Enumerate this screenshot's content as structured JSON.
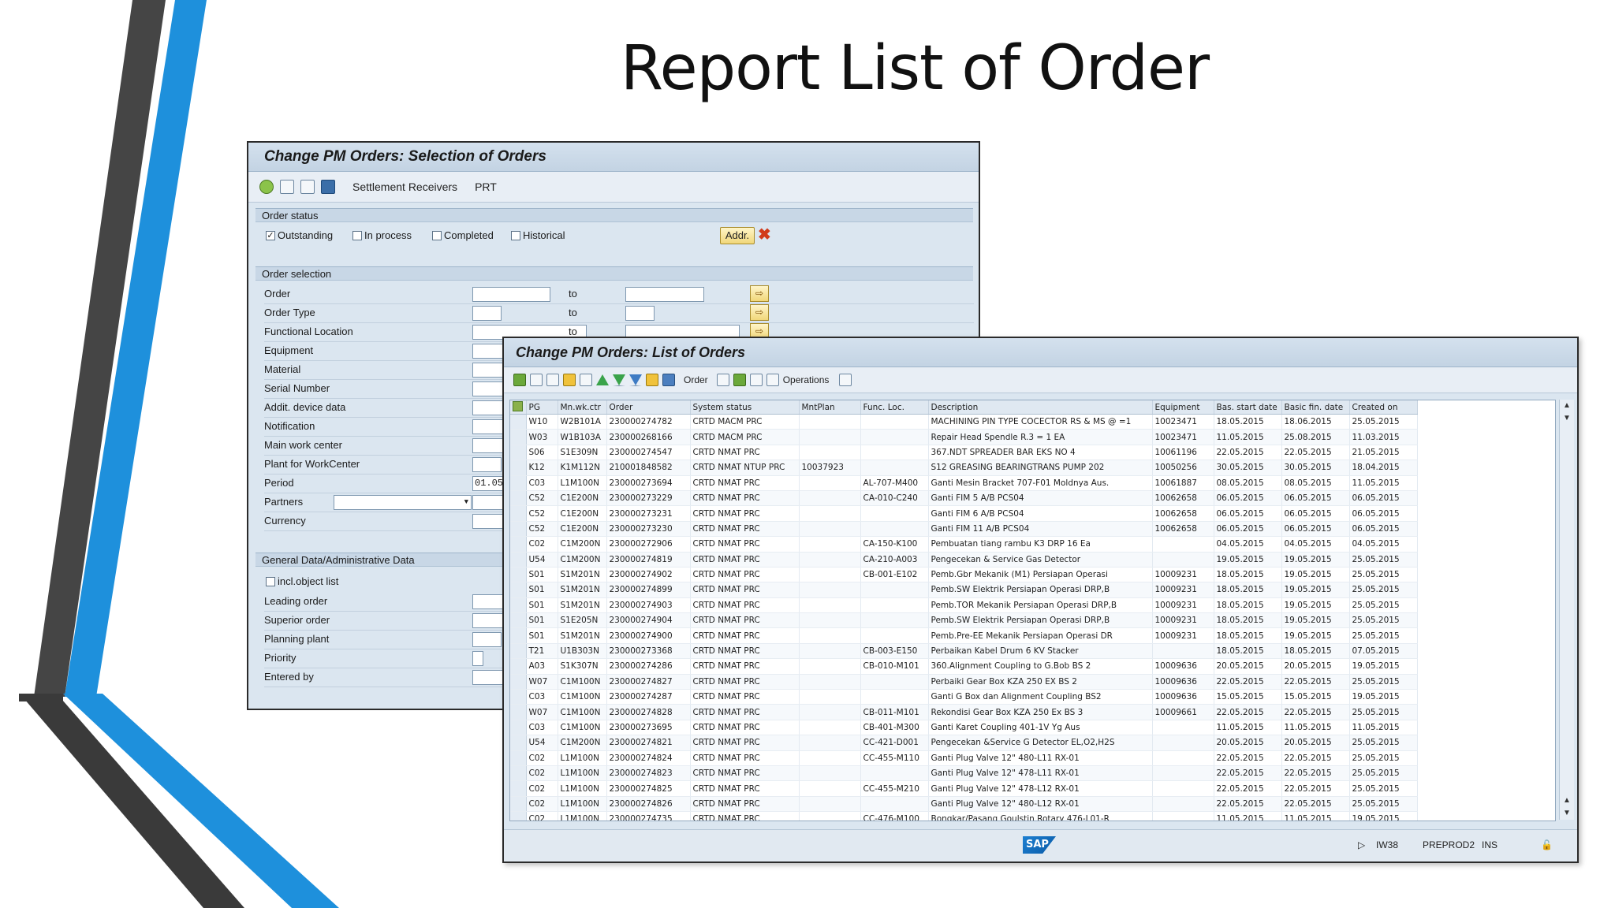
{
  "slide": {
    "title": "Report List of Order"
  },
  "colors": {
    "accent_blue": "#1e90dc",
    "accent_gray": "#4a4a4a",
    "sap_frame": "#dbe6f0"
  },
  "selection_window": {
    "title": "Change PM Orders: Selection of Orders",
    "toolbar": {
      "icons": [
        "execute-icon",
        "copy-icon",
        "get-variant-icon",
        "info-icon"
      ],
      "settlement_label": "Settlement Receivers",
      "prt_label": "PRT"
    },
    "order_status": {
      "header": "Order status",
      "outstanding": "Outstanding",
      "outstanding_checked": true,
      "in_process": "In process",
      "completed": "Completed",
      "historical": "Historical",
      "addr_button": "Addr."
    },
    "order_selection": {
      "header": "Order selection",
      "to_label": "to",
      "rows": {
        "order": "Order",
        "order_type": "Order Type",
        "functional_location": "Functional Location",
        "equipment": "Equipment",
        "material": "Material",
        "serial_number": "Serial Number",
        "addit_device_data": "Addit. device data",
        "notification": "Notification",
        "main_work_center": "Main work center",
        "plant_for_workcenter": "Plant for WorkCenter",
        "period": "Period",
        "period_value": "01.05.",
        "partners": "Partners",
        "currency": "Currency"
      }
    },
    "general_data": {
      "header": "General Data/Administrative Data",
      "incl_object_list": "incl.object list",
      "leading_order": "Leading order",
      "superior_order": "Superior order",
      "planning_plant": "Planning plant",
      "priority": "Priority",
      "entered_by": "Entered by"
    }
  },
  "list_window": {
    "title": "Change PM Orders: List of Orders",
    "toolbar": {
      "order_label": "Order",
      "operations_label": "Operations"
    },
    "columns": [
      "PG",
      "Mn.wk.ctr",
      "Order",
      "System status",
      "MntPlan",
      "Func. Loc.",
      "Description",
      "Equipment",
      "Bas. start date",
      "Basic fin. date",
      "Created on"
    ],
    "rows": [
      [
        "W10",
        "W2B101A",
        "230000274782",
        "CRTD MACM PRC",
        "",
        "",
        "MACHINING PIN TYPE COCECTOR RS & MS @ =1",
        "10023471",
        "18.05.2015",
        "18.06.2015",
        "25.05.2015"
      ],
      [
        "W03",
        "W1B103A",
        "230000268166",
        "CRTD MACM PRC",
        "",
        "",
        "Repair Head Spendle R.3 = 1 EA",
        "10023471",
        "11.05.2015",
        "25.08.2015",
        "11.03.2015"
      ],
      [
        "S06",
        "S1E309N",
        "230000274547",
        "CRTD NMAT PRC",
        "",
        "",
        "367.NDT SPREADER BAR EKS NO 4",
        "10061196",
        "22.05.2015",
        "22.05.2015",
        "21.05.2015"
      ],
      [
        "K12",
        "K1M112N",
        "210001848582",
        "CRTD NMAT NTUP PRC",
        "10037923",
        "",
        "S12 GREASING BEARINGTRANS PUMP 202",
        "10050256",
        "30.05.2015",
        "30.05.2015",
        "18.04.2015"
      ],
      [
        "C03",
        "L1M100N",
        "230000273694",
        "CRTD NMAT PRC",
        "",
        "AL-707-M400",
        "Ganti Mesin Bracket 707-F01 Moldnya Aus.",
        "10061887",
        "08.05.2015",
        "08.05.2015",
        "11.05.2015"
      ],
      [
        "C52",
        "C1E200N",
        "230000273229",
        "CRTD NMAT PRC",
        "",
        "CA-010-C240",
        "Ganti FIM 5 A/B PCS04",
        "10062658",
        "06.05.2015",
        "06.05.2015",
        "06.05.2015"
      ],
      [
        "C52",
        "C1E200N",
        "230000273231",
        "CRTD NMAT PRC",
        "",
        "",
        "Ganti FIM 6 A/B PCS04",
        "10062658",
        "06.05.2015",
        "06.05.2015",
        "06.05.2015"
      ],
      [
        "C52",
        "C1E200N",
        "230000273230",
        "CRTD NMAT PRC",
        "",
        "",
        "Ganti FIM 11 A/B PCS04",
        "10062658",
        "06.05.2015",
        "06.05.2015",
        "06.05.2015"
      ],
      [
        "C02",
        "C1M200N",
        "230000272906",
        "CRTD NMAT PRC",
        "",
        "CA-150-K100",
        "Pembuatan tiang rambu K3 DRP 16 Ea",
        "",
        "04.05.2015",
        "04.05.2015",
        "04.05.2015"
      ],
      [
        "U54",
        "C1M200N",
        "230000274819",
        "CRTD NMAT PRC",
        "",
        "CA-210-A003",
        "Pengecekan & Service Gas Detector",
        "",
        "19.05.2015",
        "19.05.2015",
        "25.05.2015"
      ],
      [
        "S01",
        "S1M201N",
        "230000274902",
        "CRTD NMAT PRC",
        "",
        "CB-001-E102",
        "Pemb.Gbr Mekanik (M1) Persiapan Operasi",
        "10009231",
        "18.05.2015",
        "19.05.2015",
        "25.05.2015"
      ],
      [
        "S01",
        "S1M201N",
        "230000274899",
        "CRTD NMAT PRC",
        "",
        "",
        "Pemb.SW Elektrik Persiapan Operasi DRP,B",
        "10009231",
        "18.05.2015",
        "19.05.2015",
        "25.05.2015"
      ],
      [
        "S01",
        "S1M201N",
        "230000274903",
        "CRTD NMAT PRC",
        "",
        "",
        "Pemb.TOR Mekanik Persiapan Operasi DRP,B",
        "10009231",
        "18.05.2015",
        "19.05.2015",
        "25.05.2015"
      ],
      [
        "S01",
        "S1E205N",
        "230000274904",
        "CRTD NMAT PRC",
        "",
        "",
        "Pemb.SW Elektrik Persiapan Operasi DRP,B",
        "10009231",
        "18.05.2015",
        "19.05.2015",
        "25.05.2015"
      ],
      [
        "S01",
        "S1M201N",
        "230000274900",
        "CRTD NMAT PRC",
        "",
        "",
        "Pemb.Pre-EE Mekanik Persiapan Operasi DR",
        "10009231",
        "18.05.2015",
        "19.05.2015",
        "25.05.2015"
      ],
      [
        "T21",
        "U1B303N",
        "230000273368",
        "CRTD NMAT PRC",
        "",
        "CB-003-E150",
        "Perbaikan Kabel Drum 6 KV Stacker",
        "",
        "18.05.2015",
        "18.05.2015",
        "07.05.2015"
      ],
      [
        "A03",
        "S1K307N",
        "230000274286",
        "CRTD NMAT PRC",
        "",
        "CB-010-M101",
        "360.Alignment Coupling to G.Bob BS 2",
        "10009636",
        "20.05.2015",
        "20.05.2015",
        "19.05.2015"
      ],
      [
        "W07",
        "C1M100N",
        "230000274827",
        "CRTD NMAT PRC",
        "",
        "",
        "Perbaiki Gear Box KZA 250 EX BS 2",
        "10009636",
        "22.05.2015",
        "22.05.2015",
        "25.05.2015"
      ],
      [
        "C03",
        "C1M100N",
        "230000274287",
        "CRTD NMAT PRC",
        "",
        "",
        "Ganti G Box dan Alignment Coupling BS2",
        "10009636",
        "15.05.2015",
        "15.05.2015",
        "19.05.2015"
      ],
      [
        "W07",
        "C1M100N",
        "230000274828",
        "CRTD NMAT PRC",
        "",
        "CB-011-M101",
        "Rekondisi Gear Box KZA 250 Ex BS 3",
        "10009661",
        "22.05.2015",
        "22.05.2015",
        "25.05.2015"
      ],
      [
        "C03",
        "C1M100N",
        "230000273695",
        "CRTD NMAT PRC",
        "",
        "CB-401-M300",
        "Ganti Karet Coupling 401-1V Yg Aus",
        "",
        "11.05.2015",
        "11.05.2015",
        "11.05.2015"
      ],
      [
        "U54",
        "C1M200N",
        "230000274821",
        "CRTD NMAT PRC",
        "",
        "CC-421-D001",
        "Pengecekan &Service G Detector EL,O2,H2S",
        "",
        "20.05.2015",
        "20.05.2015",
        "25.05.2015"
      ],
      [
        "C02",
        "L1M100N",
        "230000274824",
        "CRTD NMAT PRC",
        "",
        "CC-455-M110",
        "Ganti Plug Valve 12\" 480-L11 RX-01",
        "",
        "22.05.2015",
        "22.05.2015",
        "25.05.2015"
      ],
      [
        "C02",
        "L1M100N",
        "230000274823",
        "CRTD NMAT PRC",
        "",
        "",
        "Ganti Plug Valve 12\" 478-L11 RX-01",
        "",
        "22.05.2015",
        "22.05.2015",
        "25.05.2015"
      ],
      [
        "C02",
        "L1M100N",
        "230000274825",
        "CRTD NMAT PRC",
        "",
        "CC-455-M210",
        "Ganti Plug Valve 12\" 478-L12 RX-01",
        "",
        "22.05.2015",
        "22.05.2015",
        "25.05.2015"
      ],
      [
        "C02",
        "L1M100N",
        "230000274826",
        "CRTD NMAT PRC",
        "",
        "",
        "Ganti Plug Valve 12\" 480-L12 RX-01",
        "",
        "22.05.2015",
        "22.05.2015",
        "25.05.2015"
      ],
      [
        "C02",
        "L1M100N",
        "230000274735",
        "CRTD NMAT PRC",
        "",
        "CC-476-M100",
        "Bongkar/Pasang Goulstin Rotary 476-L01-R",
        "",
        "11.05.2015",
        "11.05.2015",
        "19.05.2015"
      ]
    ],
    "statusbar": {
      "logo": "SAP",
      "transaction": "IW38",
      "system": "PREPROD2",
      "mode": "INS"
    }
  }
}
